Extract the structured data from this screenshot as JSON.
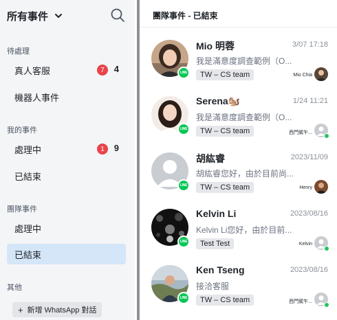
{
  "sidebar": {
    "title": "所有事件",
    "sections": [
      {
        "label": "待處理"
      },
      {
        "label": "我的事件"
      },
      {
        "label": "團隊事件"
      },
      {
        "label": "其他"
      }
    ],
    "items": [
      {
        "label": "真人客服",
        "badge": "7",
        "count": "4"
      },
      {
        "label": "機器人事件"
      },
      {
        "label": "處理中",
        "badge": "1",
        "count": "9"
      },
      {
        "label": "已結束"
      },
      {
        "label": "處理中"
      },
      {
        "label": "已結束"
      }
    ],
    "whatsapp_button": {
      "plus": "+",
      "label": "新增 WhatsApp 對話"
    }
  },
  "main": {
    "title": "團隊事件 - 已結束",
    "conversations": [
      {
        "name": "Mio 明蓉",
        "time": "3/07 17:18",
        "message": "我是滿意度調查範例（O...",
        "tag": "TW – CS team",
        "agent": "Mio Chia",
        "channel": "LINE"
      },
      {
        "name": "Serena🐿️",
        "time": "1/24 11:21",
        "message": "我是滿意度調查範例（O...",
        "tag": "TW – CS team",
        "agent": "西門駕午...",
        "channel": "LINE"
      },
      {
        "name": "胡紘睿",
        "time": "2023/11/09",
        "message": "胡紘睿您好，由於目前尚...",
        "tag": "TW – CS team",
        "agent": "Henry",
        "channel": "LINE"
      },
      {
        "name": "Kelvin Li",
        "time": "2023/08/16",
        "message": "Kelvin Li您好，由於目前...",
        "tag": "Test Test",
        "agent": "Kelvin",
        "channel": "LINE"
      },
      {
        "name": "Ken Tseng",
        "time": "2023/08/16",
        "message": "接洽客服",
        "tag": "TW – CS team",
        "agent": "西門駕午...",
        "channel": "LINE"
      }
    ]
  },
  "colors": {
    "sidebar_bg": "#f4f5f7",
    "active_item_bg": "#d4e6f8",
    "badge_red": "#e8444b",
    "line_green": "#06c755",
    "online_green": "#22c55e"
  },
  "icons": {
    "dropdown": "chevron-down-icon",
    "search": "search-icon",
    "channel": "line-icon",
    "online": "online-status-icon"
  }
}
